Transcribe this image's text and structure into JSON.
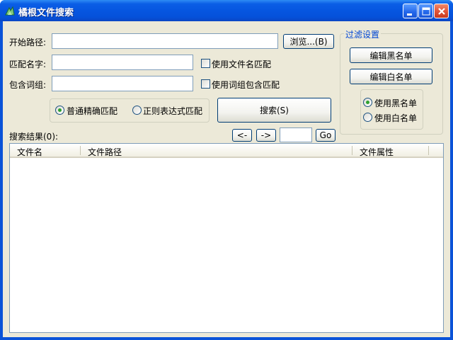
{
  "window": {
    "title": "橘根文件搜索"
  },
  "search": {
    "start_path_label": "开始路径:",
    "start_path_value": "",
    "browse_button": "浏览...(B)",
    "match_name_label": "匹配名字:",
    "match_name_value": "",
    "use_filename_match": "使用文件名匹配",
    "contains_words_label": "包含词组:",
    "contains_words_value": "",
    "use_phrase_match": "使用词组包含匹配",
    "mode_exact": "普通精确匹配",
    "mode_regex": "正则表达式匹配",
    "mode_selected": "exact",
    "search_button": "搜索(S)"
  },
  "filter": {
    "title": "过滤设置",
    "edit_blacklist": "编辑黑名单",
    "edit_whitelist": "编辑白名单",
    "use_blacklist": "使用黑名单",
    "use_whitelist": "使用白名单",
    "selected": "blacklist"
  },
  "results": {
    "label": "搜索结果(0):",
    "prev_button": "<-",
    "next_button": "->",
    "page_value": "",
    "go_button": "Go",
    "columns": [
      "文件名",
      "文件路径",
      "文件属性"
    ],
    "rows": []
  },
  "colors": {
    "titlebar": "#0656e0",
    "client_bg": "#ece9d8",
    "group_title": "#0046d5",
    "radio_dot": "#2ea12e"
  }
}
